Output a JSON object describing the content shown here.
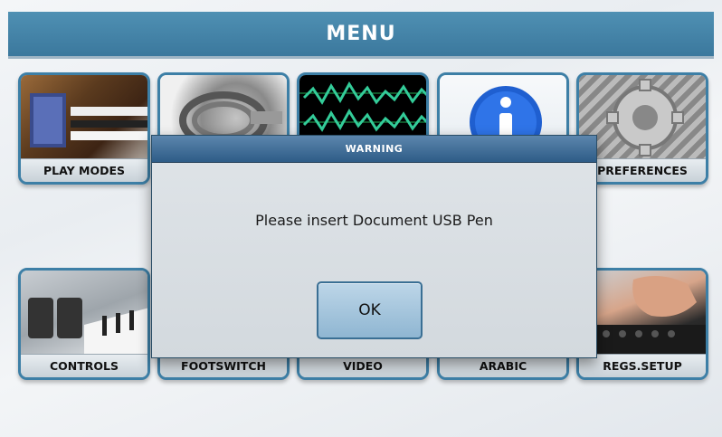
{
  "header": {
    "title": "MENU"
  },
  "tiles": [
    {
      "label": "PLAY MODES",
      "icon": "accordion-organ-icon"
    },
    {
      "label": "",
      "icon": "usb-cable-icon"
    },
    {
      "label": "",
      "icon": "waveform-icon"
    },
    {
      "label": "",
      "icon": "info-icon"
    },
    {
      "label": "PREFERENCES",
      "icon": "gear-icon"
    },
    {
      "label": "CONTROLS",
      "icon": "keyboard-controls-icon"
    },
    {
      "label": "FOOTSWITCH",
      "icon": "footswitch-icon"
    },
    {
      "label": "VIDEO",
      "icon": "video-icon"
    },
    {
      "label": "ARABIC",
      "icon": "arabic-icon"
    },
    {
      "label": "REGS.SETUP",
      "icon": "hand-keyboard-icon"
    }
  ],
  "dialog": {
    "title": "WARNING",
    "message": "Please insert Document USB Pen",
    "ok_label": "OK"
  },
  "colors": {
    "header": "#3b789d",
    "dialog_titlebar": "#2e5c87",
    "tile_border": "#3d7fa6",
    "ok_button": "#8fb6d2"
  }
}
